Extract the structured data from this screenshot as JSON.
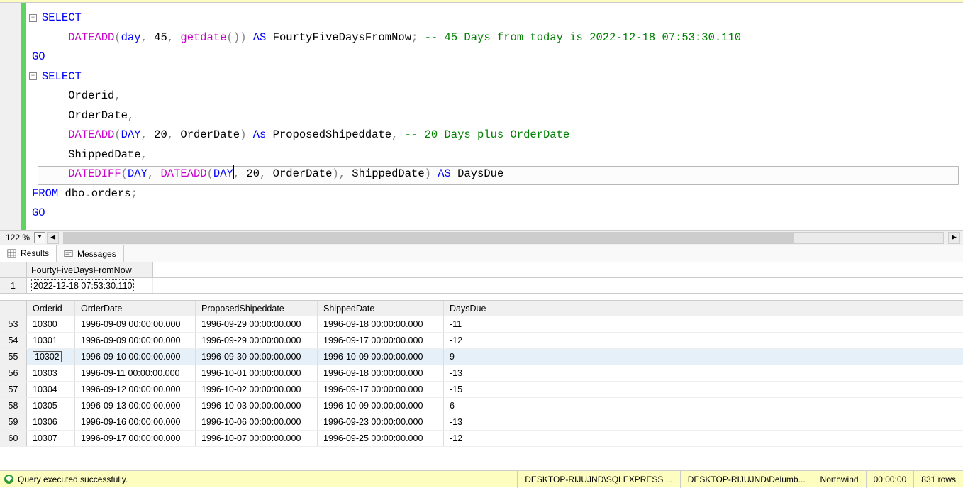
{
  "zoom": "122 %",
  "tabs": {
    "results": "Results",
    "messages": "Messages"
  },
  "code": {
    "l1": {
      "select": "SELECT"
    },
    "l2": {
      "fn": "DATEADD",
      "p1": "(",
      "kw1": "day",
      "c1": ",",
      "v": " 45",
      "c2": ",",
      "sp": " ",
      "fn2": "getdate",
      "p2": "()",
      "p3": ")",
      "as": " AS",
      "alias": " FourtyFiveDaysFromNow",
      "semi": ";",
      "comment": " -- 45 Days from today is 2022-12-18 07:53:30.110"
    },
    "l3": {
      "go": "GO"
    },
    "l4": {
      "select": "SELECT"
    },
    "l5": {
      "t": "    Orderid",
      "c": ","
    },
    "l6": {
      "t": "    OrderDate",
      "c": ","
    },
    "l7": {
      "fn": "DATEADD",
      "p1": "(",
      "kw1": "DAY",
      "c1": ",",
      "v": " 20",
      "c2": ",",
      "col": " OrderDate",
      "p2": ")",
      "as": " As",
      "alias": " ProposedShipeddate",
      "c3": ",",
      "comment": " -- 20 Days plus OrderDate"
    },
    "l8": {
      "t": "    ShippedDate",
      "c": ","
    },
    "l9": {
      "fn1": "DATEDIFF",
      "p1": "(",
      "kw1": "DAY",
      "c1": ",",
      "sp1": " ",
      "fn2": "DATEADD",
      "p2": "(",
      "kw2": "DAY",
      "c2": ",",
      "v": " 20",
      "c3": ",",
      "col1": " OrderDate",
      "p3": ")",
      "c4": ",",
      "col2": " ShippedDate",
      "p4": ")",
      "as": " AS",
      "alias": " DaysDue"
    },
    "l10": {
      "from": "FROM",
      "tbl": " dbo",
      "dot": ".",
      "tbl2": "orders",
      "semi": ";"
    },
    "l11": {
      "go": "GO"
    }
  },
  "grid1": {
    "header": "FourtyFiveDaysFromNow",
    "row": {
      "n": "1",
      "v": "2022-12-18 07:53:30.110"
    }
  },
  "grid2": {
    "headers": {
      "orderid": "Orderid",
      "orderdate": "OrderDate",
      "proposed": "ProposedShipeddate",
      "shipped": "ShippedDate",
      "daysdue": "DaysDue"
    },
    "rows": [
      {
        "n": "53",
        "orderid": "10300",
        "orderdate": "1996-09-09 00:00:00.000",
        "proposed": "1996-09-29 00:00:00.000",
        "shipped": "1996-09-18 00:00:00.000",
        "daysdue": "-11"
      },
      {
        "n": "54",
        "orderid": "10301",
        "orderdate": "1996-09-09 00:00:00.000",
        "proposed": "1996-09-29 00:00:00.000",
        "shipped": "1996-09-17 00:00:00.000",
        "daysdue": "-12"
      },
      {
        "n": "55",
        "orderid": "10302",
        "orderdate": "1996-09-10 00:00:00.000",
        "proposed": "1996-09-30 00:00:00.000",
        "shipped": "1996-10-09 00:00:00.000",
        "daysdue": "9"
      },
      {
        "n": "56",
        "orderid": "10303",
        "orderdate": "1996-09-11 00:00:00.000",
        "proposed": "1996-10-01 00:00:00.000",
        "shipped": "1996-09-18 00:00:00.000",
        "daysdue": "-13"
      },
      {
        "n": "57",
        "orderid": "10304",
        "orderdate": "1996-09-12 00:00:00.000",
        "proposed": "1996-10-02 00:00:00.000",
        "shipped": "1996-09-17 00:00:00.000",
        "daysdue": "-15"
      },
      {
        "n": "58",
        "orderid": "10305",
        "orderdate": "1996-09-13 00:00:00.000",
        "proposed": "1996-10-03 00:00:00.000",
        "shipped": "1996-10-09 00:00:00.000",
        "daysdue": "6"
      },
      {
        "n": "59",
        "orderid": "10306",
        "orderdate": "1996-09-16 00:00:00.000",
        "proposed": "1996-10-06 00:00:00.000",
        "shipped": "1996-09-23 00:00:00.000",
        "daysdue": "-13"
      },
      {
        "n": "60",
        "orderid": "10307",
        "orderdate": "1996-09-17 00:00:00.000",
        "proposed": "1996-10-07 00:00:00.000",
        "shipped": "1996-09-25 00:00:00.000",
        "daysdue": "-12"
      }
    ]
  },
  "status": {
    "ok": "Query executed successfully.",
    "server": "DESKTOP-RIJUJND\\SQLEXPRESS ...",
    "user": "DESKTOP-RIJUJND\\Delumb...",
    "db": "Northwind",
    "time": "00:00:00",
    "rows": "831 rows"
  }
}
